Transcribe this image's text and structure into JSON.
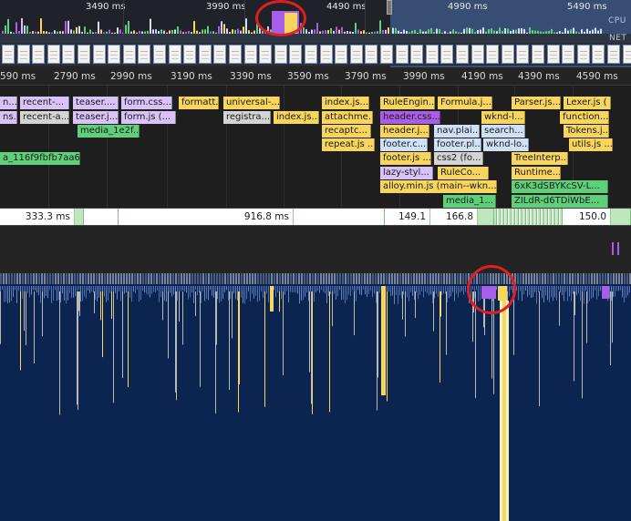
{
  "overview": {
    "ticks": [
      "3490 ms",
      "3990 ms",
      "4490 ms",
      "4990 ms",
      "5490 ms"
    ],
    "cpu_label": "CPU",
    "net_label": "NET"
  },
  "ruler": {
    "ticks": [
      "590 ms",
      "2790 ms",
      "2990 ms",
      "3190 ms",
      "3390 ms",
      "3590 ms",
      "3790 ms",
      "3990 ms",
      "4190 ms",
      "4390 ms",
      "4590 ms"
    ]
  },
  "flame": {
    "row1": [
      "n...",
      "recent-...",
      "teaser....",
      "form.css...",
      "formatt...",
      "universal-...",
      "index.js...",
      "RuleEngin...",
      "Formula.j...",
      "Parser.js...",
      "Lexer.js ("
    ],
    "row2": [
      "ns...",
      "recent-a...",
      "teaser.j...",
      "form.js (...",
      "registra...",
      "index.js...",
      "attachme...",
      "header.css...",
      "wknd-l...",
      "function..."
    ],
    "row3": [
      "media_1e2f...",
      "recaptc...",
      "header.j...",
      "nav.plai...",
      "search...",
      "Tokens.j..."
    ],
    "row4": [
      "repeat.js ...",
      "footer.c...",
      "footer.pl...",
      "wknd-lo...",
      "utils.js ..."
    ],
    "row5": [
      "a_116f9fbfb7aa6...",
      "footer.js ...",
      "css2 (fo...",
      "TreeInterp..."
    ],
    "row6": [
      "lazy-styl...",
      "RuleCo...",
      "Runtime..."
    ],
    "row7": [
      "alloy.min.js (main--wkn...",
      "6xK3dSBYKcSV-L..."
    ],
    "row8": [
      "media_1...",
      "ZILdR-d6TDiWbE..."
    ]
  },
  "timings": [
    "333.3 ms",
    "916.8 ms",
    "149.1 ms",
    "166.8 ms",
    "150.0 ms"
  ],
  "colors": {
    "yellow": "#f7d55f",
    "lavender": "#d9c2f7",
    "purple": "#a85ee6",
    "green": "#5fcf7a",
    "blue": "#cfe0f7",
    "gray": "#d4d4d4",
    "track_bg": "#0b2550",
    "highlight": "#e02020"
  }
}
